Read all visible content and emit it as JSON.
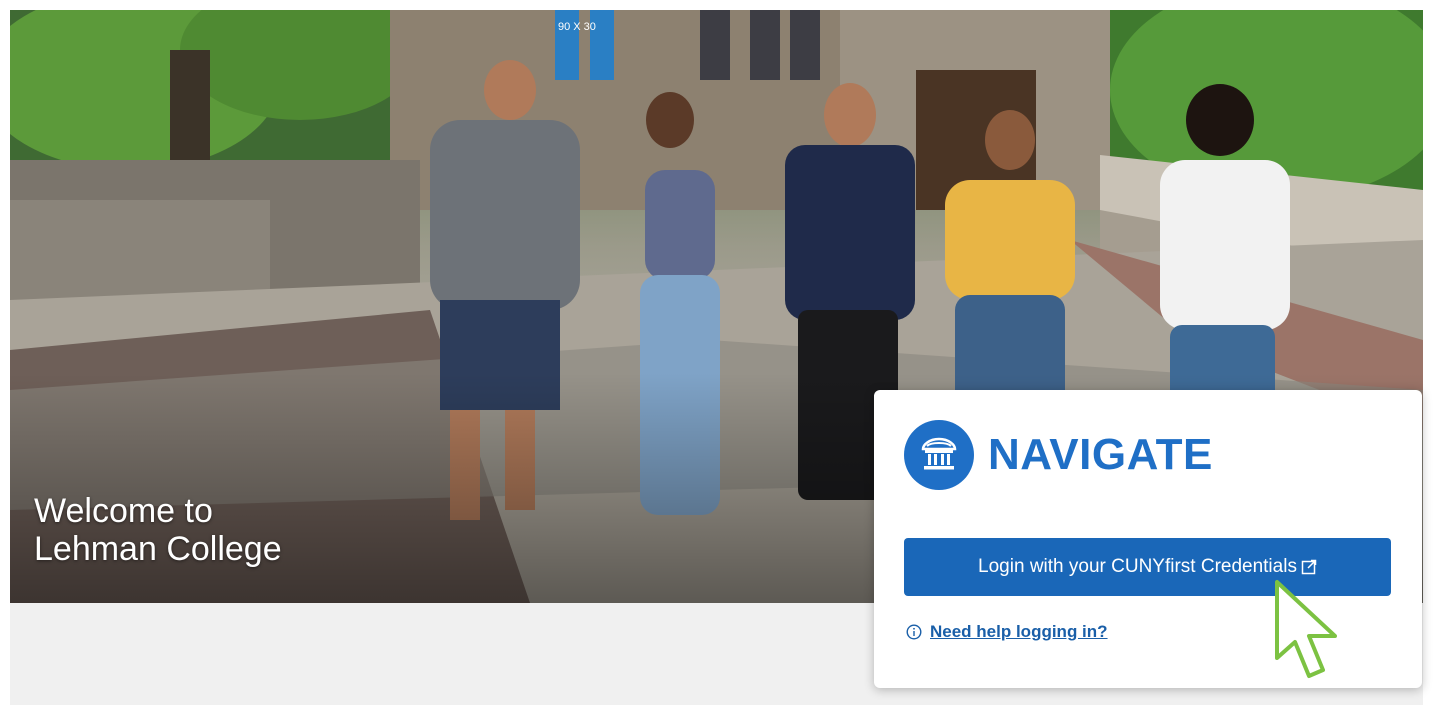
{
  "hero": {
    "welcome_line1": "Welcome to",
    "welcome_line2": "Lehman College",
    "banner_text": "90 X 30"
  },
  "login_card": {
    "brand_name": "NAVIGATE",
    "brand_icon": "institution-building-icon",
    "login_button_label": "Login with your CUNYfirst Credentials",
    "login_button_icon": "external-link-icon",
    "help_icon": "info-circle-icon",
    "help_link_label": "Need help logging in?"
  },
  "colors": {
    "brand_blue": "#1f6fc6",
    "button_blue": "#1a67b8",
    "link_blue": "#1a5fa8",
    "cursor_green": "#7cc242"
  }
}
